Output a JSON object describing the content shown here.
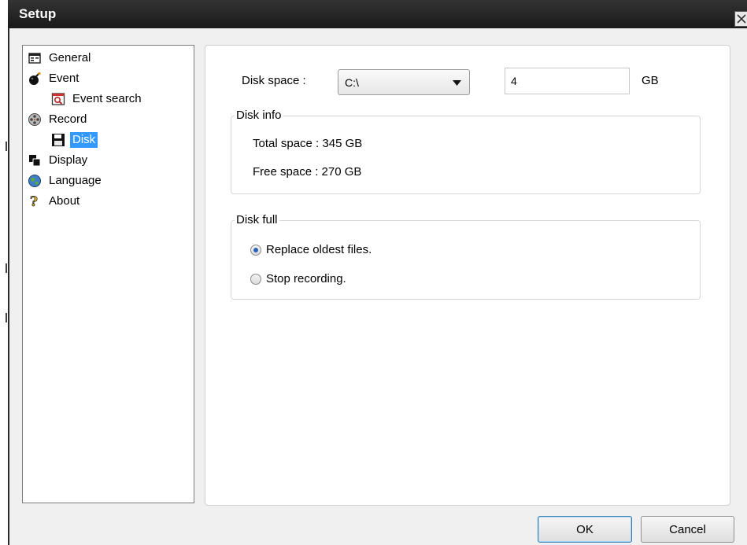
{
  "window": {
    "title": "Setup"
  },
  "tree": [
    {
      "name": "tree-item-general",
      "label": "General",
      "icon": "general-settings-icon",
      "selected": false
    },
    {
      "name": "tree-item-event",
      "label": "Event",
      "icon": "bomb-icon",
      "selected": false
    },
    {
      "name": "tree-item-event-search",
      "label": "Event search",
      "icon": "calendar-search-icon",
      "selected": false
    },
    {
      "name": "tree-item-record",
      "label": "Record",
      "icon": "film-reel-icon",
      "selected": false
    },
    {
      "name": "tree-item-disk",
      "label": "Disk",
      "icon": "floppy-disk-icon",
      "selected": true
    },
    {
      "name": "tree-item-display",
      "label": "Display",
      "icon": "display-windows-icon",
      "selected": false
    },
    {
      "name": "tree-item-language",
      "label": "Language",
      "icon": "globe-icon",
      "selected": false
    },
    {
      "name": "tree-item-about",
      "label": "About",
      "icon": "question-mark-icon",
      "selected": false
    }
  ],
  "disk_space": {
    "label": "Disk space :",
    "drive": "C:\\",
    "size_value": "4",
    "unit": "GB"
  },
  "disk_info": {
    "title": "Disk info",
    "total": "Total space : 345 GB",
    "free": "Free space : 270 GB"
  },
  "disk_full": {
    "title": "Disk full",
    "options": [
      {
        "label": "Replace oldest files.",
        "checked": true
      },
      {
        "label": "Stop recording.",
        "checked": false
      }
    ]
  },
  "buttons": {
    "ok": "OK",
    "cancel": "Cancel"
  },
  "colors": {
    "selection": "#3399ff",
    "title_bar": "#1a1a1a"
  }
}
